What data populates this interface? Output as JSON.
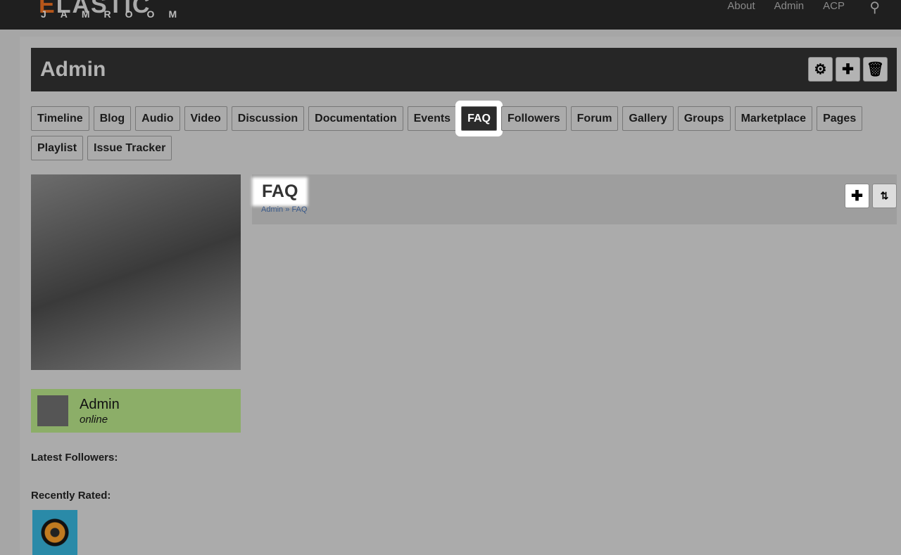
{
  "brand": {
    "logo_main": "ELASTIC",
    "logo_sub": "JAMROOM"
  },
  "nav": [
    "About",
    "Admin",
    "ACP"
  ],
  "header": {
    "title": "Admin"
  },
  "tabs": [
    "Timeline",
    "Blog",
    "Audio",
    "Video",
    "Discussion",
    "Documentation",
    "Events",
    "FAQ",
    "Followers",
    "Forum",
    "Gallery",
    "Groups",
    "Marketplace",
    "Pages",
    "Playlist",
    "Issue Tracker"
  ],
  "active_tab": "FAQ",
  "user": {
    "name": "Admin",
    "status": "online"
  },
  "sidebar": {
    "latest_followers": "Latest Followers:",
    "recently_rated": "Recently Rated:"
  },
  "panel": {
    "title": "FAQ",
    "crumb_home": "Admin",
    "crumb_sep": "»",
    "crumb_current": "FAQ"
  }
}
